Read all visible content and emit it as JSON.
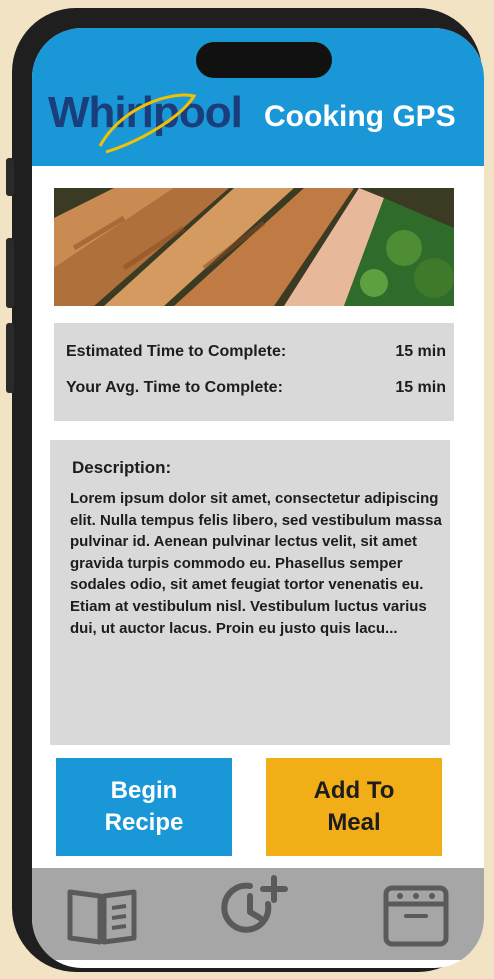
{
  "header": {
    "brand": "Whirlpool",
    "title": "Cooking GPS",
    "background_color": "#1a97d6"
  },
  "hero_image": {
    "subject": "seared salmon fillets with parsley"
  },
  "info": {
    "estimated_label": "Estimated Time to Complete:",
    "estimated_value": "15 min",
    "average_label": "Your Avg. Time to Complete:",
    "average_value": "15 min"
  },
  "description": {
    "title": "Description:",
    "body": "Lorem ipsum dolor sit amet, consectetur adipiscing elit. Nulla tempus felis libero, sed vestibulum massa pulvinar id. Aenean pulvinar lectus velit, sit amet gravida turpis commodo eu. Phasellus semper sodales odio, sit amet feugiat tortor venenatis eu. Etiam at vestibulum nisl. Vestibulum luctus varius dui, ut auctor lacus. Proin eu justo quis lacu..."
  },
  "actions": {
    "begin_label": "Begin\nRecipe",
    "add_label": "Add To\nMeal",
    "begin_color": "#1a97d6",
    "add_color": "#f2ae17"
  },
  "bottom_nav": {
    "items": [
      {
        "icon": "book-icon"
      },
      {
        "icon": "clock-plus-icon"
      },
      {
        "icon": "oven-icon"
      }
    ],
    "background_color": "#a6a6a6"
  }
}
